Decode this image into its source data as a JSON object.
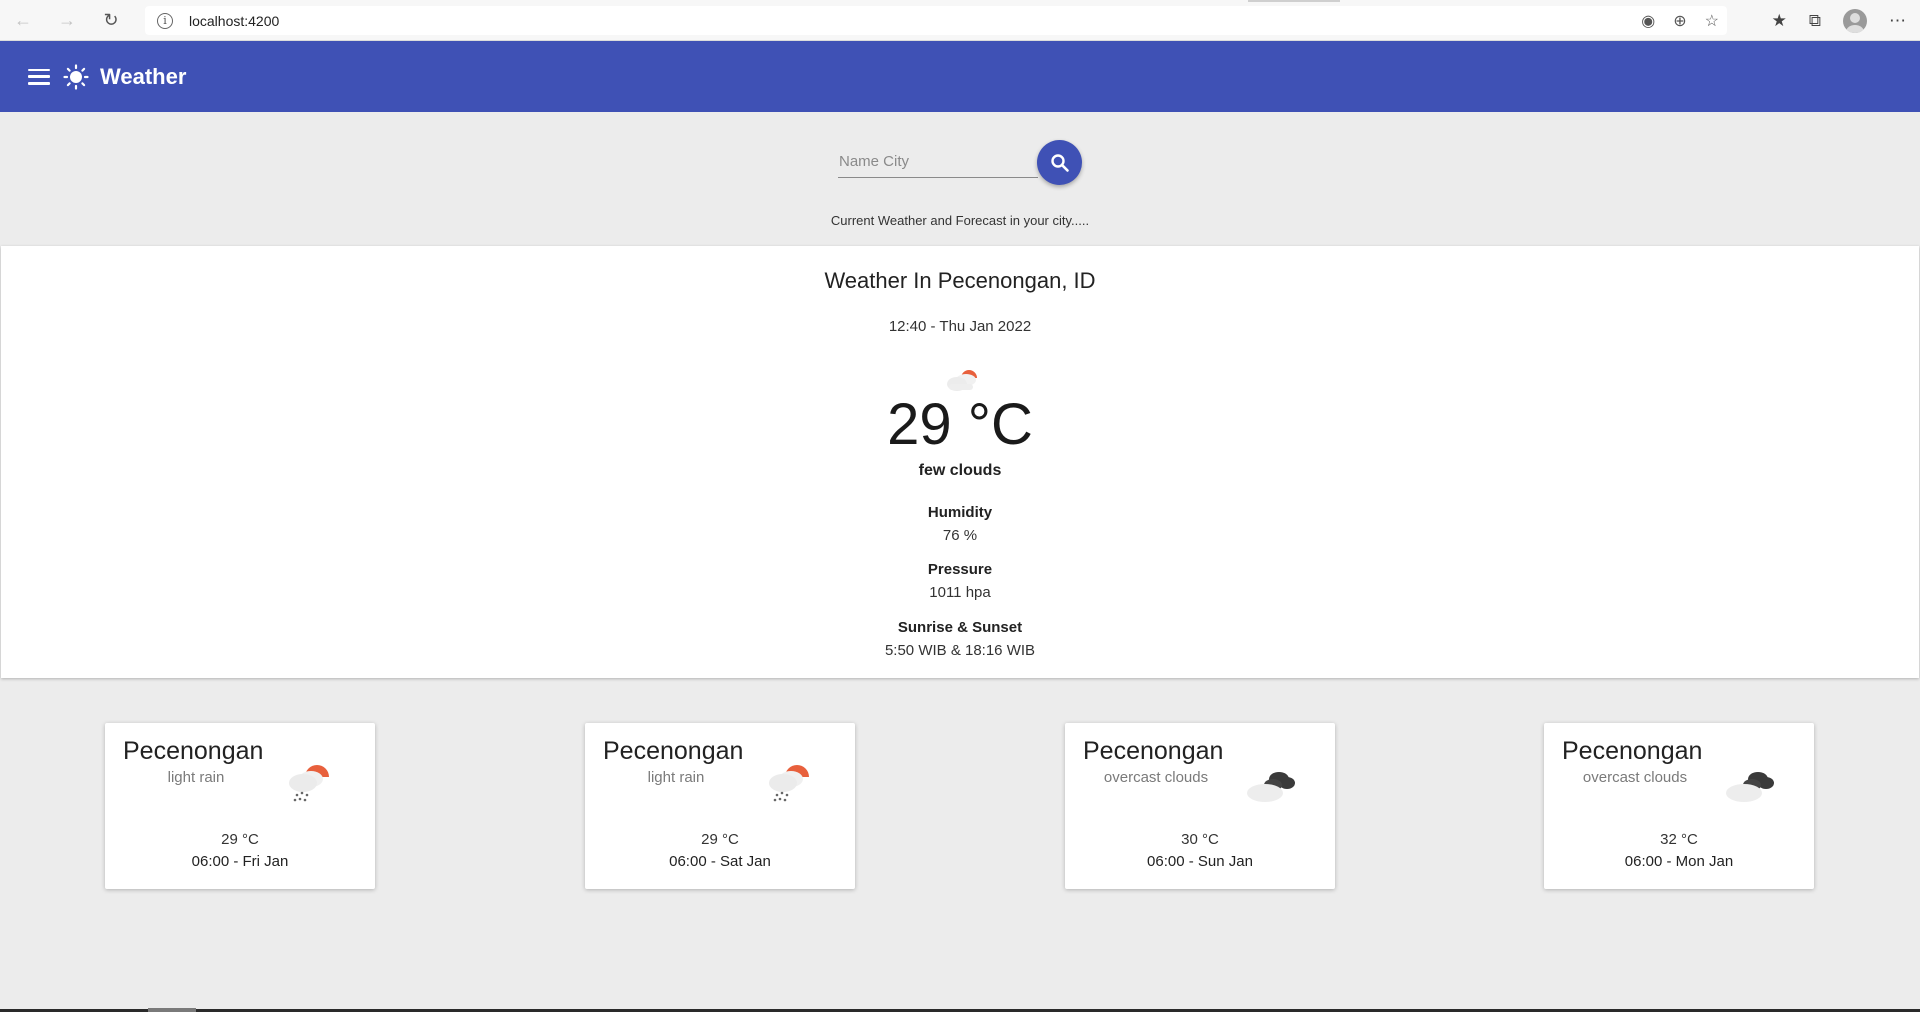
{
  "browser": {
    "url": "localhost:4200",
    "back_icon": "back-arrow-icon",
    "forward_icon": "forward-arrow-icon",
    "reload_icon": "reload-icon"
  },
  "app": {
    "title": "Weather",
    "accent_color": "#3f51b5"
  },
  "search": {
    "placeholder": "Name City",
    "value": ""
  },
  "tagline": "Current Weather and Forecast in your city.....",
  "current": {
    "title": "Weather In Pecenongan, ID",
    "time": "12:40 - Thu Jan 2022",
    "temperature": "29 °C",
    "description": "few clouds",
    "humidity_label": "Humidity",
    "humidity_value": "76 %",
    "pressure_label": "Pressure",
    "pressure_value": "1011 hpa",
    "sun_label": "Sunrise & Sunset",
    "sun_value": "5:50 WIB & 18:16 WIB",
    "icon": "few-clouds-day-icon"
  },
  "forecast": [
    {
      "city": "Pecenongan",
      "description": "light rain",
      "temperature": "29 °C",
      "date": "06:00 - Fri Jan",
      "icon": "light-rain-icon"
    },
    {
      "city": "Pecenongan",
      "description": "light rain",
      "temperature": "29 °C",
      "date": "06:00 - Sat Jan",
      "icon": "light-rain-icon"
    },
    {
      "city": "Pecenongan",
      "description": "overcast clouds",
      "temperature": "30 °C",
      "date": "06:00 - Sun Jan",
      "icon": "overcast-clouds-icon"
    },
    {
      "city": "Pecenongan",
      "description": "overcast clouds",
      "temperature": "32 °C",
      "date": "06:00 - Mon Jan",
      "icon": "overcast-clouds-icon"
    }
  ]
}
